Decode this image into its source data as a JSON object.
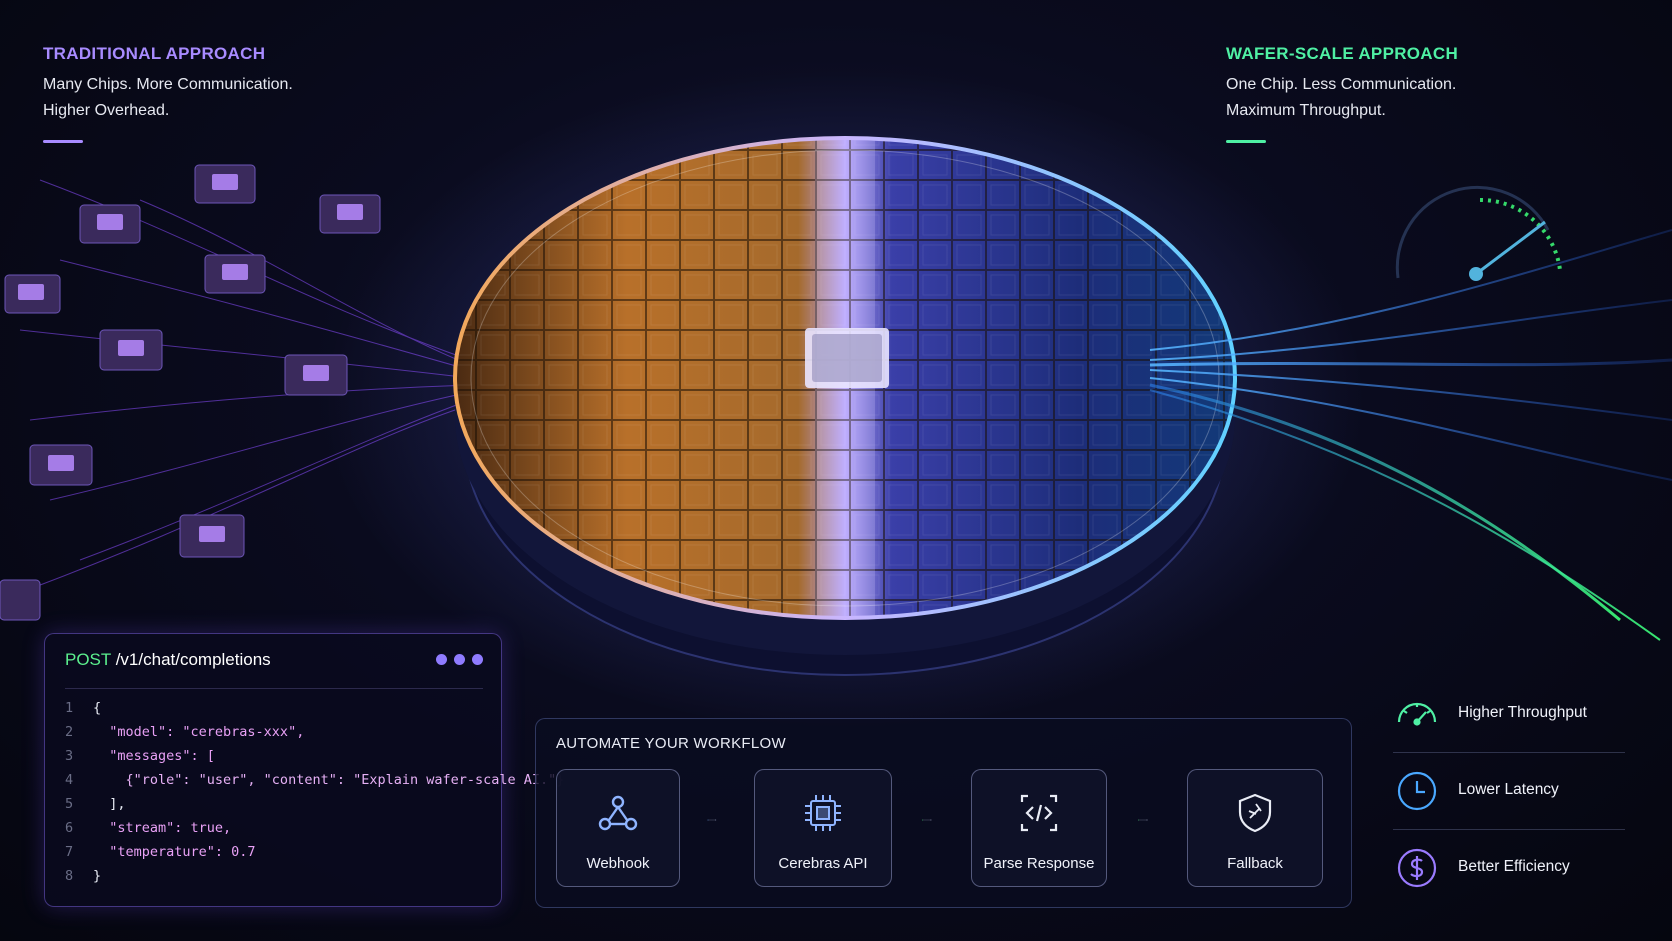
{
  "left": {
    "heading": "TRADITIONAL APPROACH",
    "line1": "Many Chips. More Communication.",
    "line2": "Higher Overhead.",
    "accent": "#a88bff"
  },
  "right": {
    "heading": "WAFER-SCALE APPROACH",
    "line1": "One Chip. Less Communication.",
    "line2": "Maximum Throughput.",
    "accent": "#4ff0a4"
  },
  "code": {
    "verb": "POST",
    "path": " /v1/chat/completions",
    "lines": [
      {
        "n": "1",
        "text": "{"
      },
      {
        "n": "2",
        "text": "  \"model\": \"cerebras-xxx\","
      },
      {
        "n": "3",
        "text": "  \"messages\": ["
      },
      {
        "n": "4",
        "text": "    {\"role\": \"user\", \"content\": \"Explain wafer-scale AI.\"}"
      },
      {
        "n": "5",
        "text": "  ],"
      },
      {
        "n": "6",
        "text": "  \"stream\": true,"
      },
      {
        "n": "7",
        "text": "  \"temperature\": 0.7"
      },
      {
        "n": "8",
        "text": "}"
      }
    ]
  },
  "workflow": {
    "title": "AUTOMATE YOUR WORKFLOW",
    "nodes": [
      {
        "label": "Webhook",
        "icon": "webhook-icon"
      },
      {
        "label": "Cerebras API",
        "icon": "chip-icon"
      },
      {
        "label": "Parse Response",
        "icon": "code-icon"
      },
      {
        "label": "Fallback",
        "icon": "shield-icon"
      }
    ]
  },
  "benefits": [
    {
      "label": "Higher Throughput",
      "icon": "speedometer-icon",
      "color": "#4ff0a4"
    },
    {
      "label": "Lower Latency",
      "icon": "clock-icon",
      "color": "#4aa8ff"
    },
    {
      "label": "Better Efficiency",
      "icon": "dollar-icon",
      "color": "#9a7bff"
    }
  ]
}
